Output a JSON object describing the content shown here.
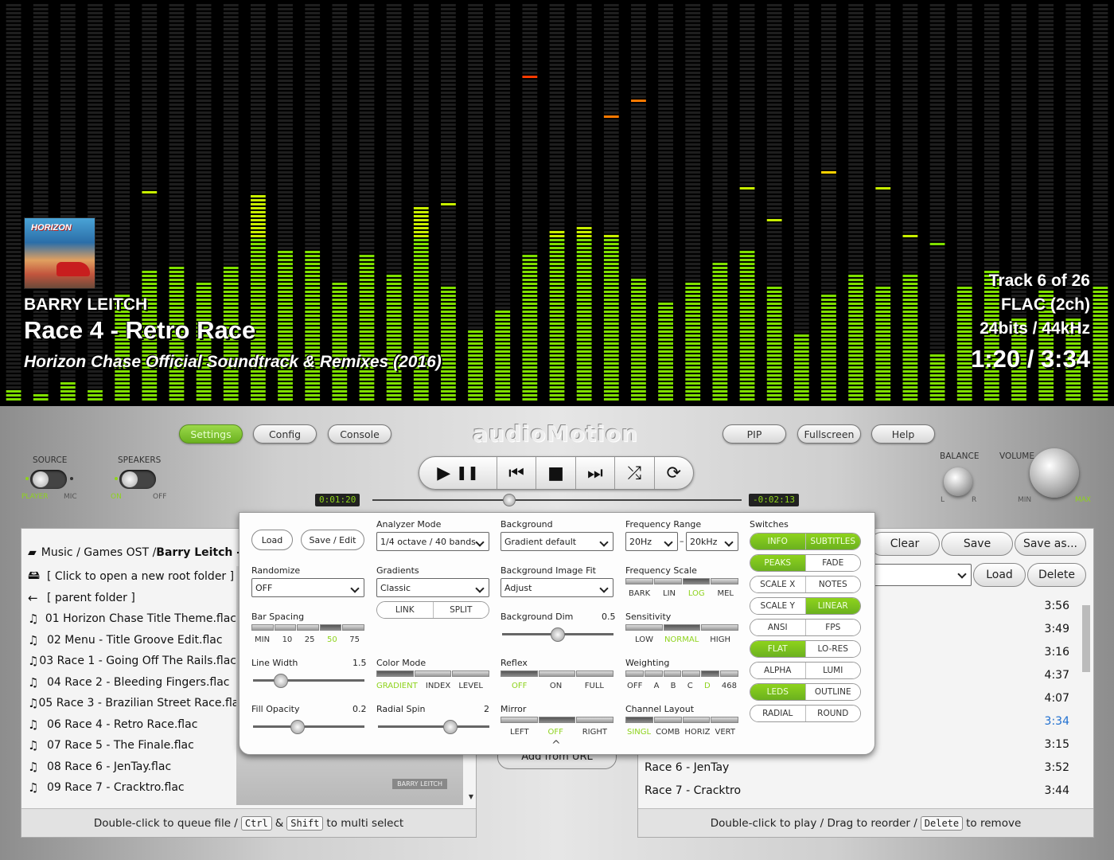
{
  "now_playing": {
    "artist": "BARRY LEITCH",
    "title": "Race 4 - Retro Race",
    "album": "Horizon Chase Official Soundtrack & Remixes (2016)",
    "track": "Track 6 of 26",
    "format": "FLAC (2ch)",
    "bits": "24bits / 44kHz",
    "time": "1:20 / 3:34",
    "cover_text": "HORIZON"
  },
  "analyzer_levels": [
    0.03,
    0.02,
    0.05,
    0.03,
    0.27,
    0.33,
    0.34,
    0.3,
    0.34,
    0.52,
    0.37,
    0.37,
    0.3,
    0.36,
    0.32,
    0.49,
    0.29,
    0.18,
    0.23,
    0.37,
    0.43,
    0.44,
    0.42,
    0.31,
    0.25,
    0.3,
    0.35,
    0.38,
    0.29,
    0.17,
    0.27,
    0.32,
    0.29,
    0.32,
    0.12,
    0.29,
    0.33,
    0.21,
    0.28,
    0.21,
    0.29
  ],
  "analyzer_peaks": [
    null,
    null,
    null,
    null,
    null,
    0.52,
    null,
    null,
    null,
    null,
    0.37,
    0.37,
    null,
    0.36,
    null,
    null,
    0.49,
    null,
    null,
    0.81,
    null,
    null,
    0.71,
    0.75,
    null,
    null,
    null,
    0.53,
    0.45,
    null,
    0.57,
    null,
    0.53,
    0.41,
    0.39,
    null,
    null,
    null,
    null,
    null,
    null
  ],
  "colors": {
    "accent": "#8ed31c",
    "peak_red": "#ff3300",
    "bg": "#000000"
  },
  "toolbar": {
    "settings": "Settings",
    "config": "Config",
    "console": "Console",
    "logo": "audioMotion",
    "pip": "PIP",
    "fullscreen": "Fullscreen",
    "help": "Help"
  },
  "source": {
    "label": "SOURCE",
    "opt1": "PLAYER",
    "opt2": "MIC"
  },
  "speakers": {
    "label": "SPEAKERS",
    "opt1": "ON",
    "opt2": "OFF"
  },
  "transport": {
    "play": "▶",
    "pause": "❚❚",
    "prev": "⏮",
    "stop": "■",
    "next": "⏭",
    "shuffle": "⤮",
    "repeat": "⟳"
  },
  "position": {
    "elapsed": "0:01:20",
    "remaining": "-0:02:13",
    "progress": 0.37
  },
  "balance": {
    "label": "BALANCE",
    "l": "L",
    "r": "R"
  },
  "volume": {
    "label": "VOLUME",
    "min": "MIN",
    "max": "MAX"
  },
  "file_explorer": {
    "breadcrumb_prefix": "Music / Games OST / ",
    "breadcrumb_current": "Barry Leitch - Ho",
    "items": [
      {
        "icon": "drive-icon",
        "glyph": "🖴",
        "name": "[ Click to open a new root folder ]"
      },
      {
        "icon": "back-arrow-icon",
        "glyph": "←",
        "name": "[ parent folder ]"
      },
      {
        "icon": "music-note-icon",
        "glyph": "♫",
        "name": "01 Horizon Chase Title Theme.flac"
      },
      {
        "icon": "music-note-icon",
        "glyph": "♫",
        "name": "02 Menu - Title Groove Edit.flac"
      },
      {
        "icon": "music-note-icon",
        "glyph": "♫",
        "name": "03 Race 1 - Going Off The Rails.flac"
      },
      {
        "icon": "music-note-icon",
        "glyph": "♫",
        "name": "04 Race 2 - Bleeding Fingers.flac"
      },
      {
        "icon": "music-note-icon",
        "glyph": "♫",
        "name": "05 Race 3 - Brazilian Street Race.flac"
      },
      {
        "icon": "music-note-icon",
        "glyph": "♫",
        "name": "06 Race 4 - Retro Race.flac"
      },
      {
        "icon": "music-note-icon",
        "glyph": "♫",
        "name": "07 Race 5 - The Finale.flac"
      },
      {
        "icon": "music-note-icon",
        "glyph": "♫",
        "name": "08 Race 6 - JenTay.flac"
      },
      {
        "icon": "music-note-icon",
        "glyph": "♫",
        "name": "09 Race 7 - Cracktro.flac"
      }
    ],
    "footer_pre": "Double-click to queue file /",
    "key1": "Ctrl",
    "amp": "&",
    "key2": "Shift",
    "footer_post": "to multi select",
    "album_caption": "BARRY LEITCH"
  },
  "add_url": "Add from URL",
  "playlist": {
    "clear": "Clear",
    "save": "Save",
    "save_as": "Save as...",
    "load": "Load",
    "delete": "Delete",
    "items": [
      {
        "name": "",
        "dur": "3:56"
      },
      {
        "name": "",
        "dur": "3:49"
      },
      {
        "name": "",
        "dur": "3:16"
      },
      {
        "name": "",
        "dur": "4:37"
      },
      {
        "name": "",
        "dur": "4:07"
      },
      {
        "name": "",
        "dur": "3:34",
        "current": true
      },
      {
        "name": "",
        "dur": "3:15"
      },
      {
        "name": "Race 6 - JenTay",
        "dur": "3:52"
      },
      {
        "name": "Race 7 - Cracktro",
        "dur": "3:44"
      }
    ],
    "footer_pre": "Double-click to play / Drag to reorder /",
    "key": "Delete",
    "footer_post": "to remove"
  },
  "settings": {
    "load": "Load",
    "save_edit": "Save / Edit",
    "randomize": {
      "label": "Randomize",
      "value": "OFF"
    },
    "bar_spacing": {
      "label": "Bar Spacing",
      "options": [
        "MIN",
        "10",
        "25",
        "50",
        "75"
      ],
      "selected": "50"
    },
    "line_width": {
      "label": "Line Width",
      "value": "1.5",
      "level": 0.25
    },
    "fill_opacity": {
      "label": "Fill Opacity",
      "value": "0.2",
      "level": 0.4
    },
    "analyzer_mode": {
      "label": "Analyzer Mode",
      "value": "1/4 octave / 40 bands"
    },
    "gradients": {
      "label": "Gradients",
      "value": "Classic",
      "link": "LINK",
      "split": "SPLIT"
    },
    "color_mode": {
      "label": "Color Mode",
      "options": [
        "GRADIENT",
        "INDEX",
        "LEVEL"
      ],
      "selected": "GRADIENT"
    },
    "radial_spin": {
      "label": "Radial Spin",
      "value": "2",
      "level": 0.65
    },
    "background": {
      "label": "Background",
      "value": "Gradient default"
    },
    "bg_fit": {
      "label": "Background Image Fit",
      "value": "Adjust"
    },
    "bg_dim": {
      "label": "Background Dim",
      "value": "0.5",
      "level": 0.5
    },
    "reflex": {
      "label": "Reflex",
      "options": [
        "OFF",
        "ON",
        "FULL"
      ],
      "selected": "OFF"
    },
    "mirror": {
      "label": "Mirror",
      "options": [
        "LEFT",
        "OFF",
        "RIGHT"
      ],
      "selected": "OFF"
    },
    "freq_range": {
      "label": "Frequency Range",
      "from": "20Hz",
      "dash": "–",
      "to": "20kHz"
    },
    "freq_scale": {
      "label": "Frequency Scale",
      "options": [
        "BARK",
        "LIN",
        "LOG",
        "MEL"
      ],
      "selected": "LOG"
    },
    "sensitivity": {
      "label": "Sensitivity",
      "options": [
        "LOW",
        "NORMAL",
        "HIGH"
      ],
      "selected": "NORMAL"
    },
    "weighting": {
      "label": "Weighting",
      "options": [
        "OFF",
        "A",
        "B",
        "C",
        "D",
        "468"
      ],
      "selected": "D"
    },
    "channel_layout": {
      "label": "Channel Layout",
      "options": [
        "SINGL",
        "COMB",
        "HORIZ",
        "VERT"
      ],
      "selected": "SINGL"
    },
    "switches": {
      "label": "Switches",
      "pairs": [
        [
          {
            "t": "INFO",
            "on": true
          },
          {
            "t": "SUBTITLES",
            "on": true
          }
        ],
        [
          {
            "t": "PEAKS",
            "on": true
          },
          {
            "t": "FADE",
            "on": false
          }
        ],
        [
          {
            "t": "SCALE X",
            "on": false
          },
          {
            "t": "NOTES",
            "on": false
          }
        ],
        [
          {
            "t": "SCALE Y",
            "on": false
          },
          {
            "t": "LINEAR",
            "on": true
          }
        ],
        [
          {
            "t": "ANSI",
            "on": false
          },
          {
            "t": "FPS",
            "on": false
          }
        ],
        [
          {
            "t": "FLAT",
            "on": true
          },
          {
            "t": "LO-RES",
            "on": false
          }
        ],
        [
          {
            "t": "ALPHA",
            "on": false
          },
          {
            "t": "LUMI",
            "on": false
          }
        ],
        [
          {
            "t": "LEDS",
            "on": true
          },
          {
            "t": "OUTLINE",
            "on": false
          }
        ],
        [
          {
            "t": "RADIAL",
            "on": false
          },
          {
            "t": "ROUND",
            "on": false
          }
        ]
      ]
    },
    "collapse": "^"
  }
}
